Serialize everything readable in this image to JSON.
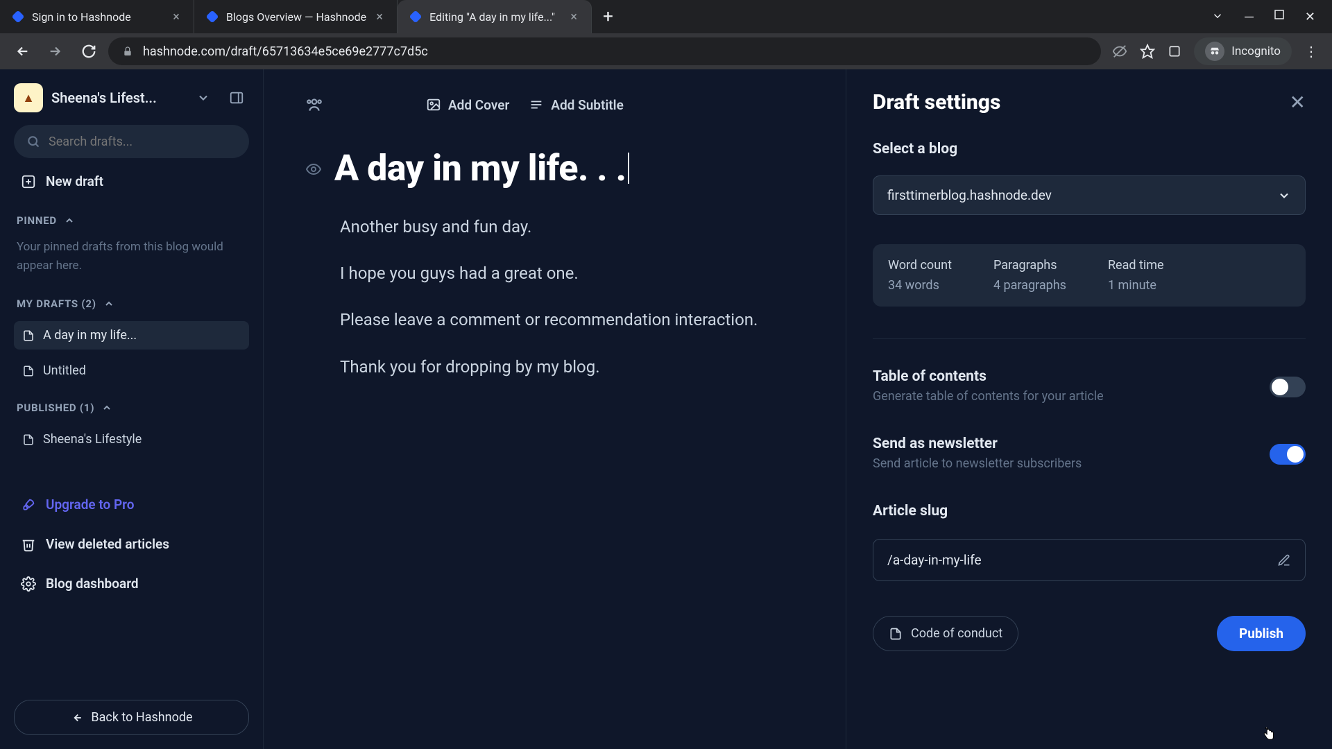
{
  "browser": {
    "tabs": [
      {
        "title": "Sign in to Hashnode"
      },
      {
        "title": "Blogs Overview — Hashnode"
      },
      {
        "title": "Editing \"A day in my life...\""
      }
    ],
    "url": "hashnode.com/draft/65713634e5ce69e2777c7d5c",
    "incognito_label": "Incognito"
  },
  "sidebar": {
    "blog_name": "Sheena's Lifest...",
    "search_placeholder": "Search drafts...",
    "new_draft": "New draft",
    "pinned_header": "PINNED",
    "pinned_empty": "Your pinned drafts from this blog would appear here.",
    "mydrafts_header": "MY DRAFTS (2)",
    "drafts": [
      {
        "title": "A day in my life..."
      },
      {
        "title": "Untitled"
      }
    ],
    "published_header": "PUBLISHED (1)",
    "published": [
      {
        "title": "Sheena's Lifestyle"
      }
    ],
    "upgrade": "Upgrade to Pro",
    "view_deleted": "View deleted articles",
    "blog_dashboard": "Blog dashboard",
    "back": "Back to Hashnode"
  },
  "editor": {
    "add_cover": "Add Cover",
    "add_subtitle": "Add Subtitle",
    "title": "A day in my life. . .",
    "paragraphs": [
      "Another busy and fun day.",
      "I hope you guys had a great one.",
      "Please leave a comment or recommendation interaction.",
      "Thank you for dropping by my blog."
    ]
  },
  "drawer": {
    "title": "Draft settings",
    "select_blog_label": "Select a blog",
    "selected_blog": "firsttimerblog.hashnode.dev",
    "stats": {
      "word_count_label": "Word count",
      "word_count_value": "34 words",
      "paragraphs_label": "Paragraphs",
      "paragraphs_value": "4 paragraphs",
      "read_time_label": "Read time",
      "read_time_value": "1 minute"
    },
    "toc_title": "Table of contents",
    "toc_desc": "Generate table of contents for your article",
    "newsletter_title": "Send as newsletter",
    "newsletter_desc": "Send article to newsletter subscribers",
    "slug_label": "Article slug",
    "slug_value": "/a-day-in-my-life",
    "coc": "Code of conduct",
    "publish": "Publish"
  }
}
